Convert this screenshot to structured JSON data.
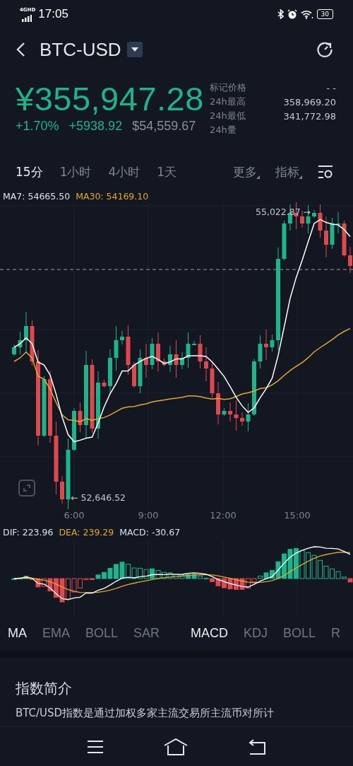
{
  "status_bar": {
    "network": "4GHD",
    "time": "17:05",
    "battery": "30"
  },
  "header": {
    "title": "BTC-USD"
  },
  "price": {
    "main": "¥355,947.28",
    "change_pct": "+1.70%",
    "change": "+5938.92",
    "usd": "$54,559.67"
  },
  "stats": [
    {
      "label": "标记价格",
      "value": "- -"
    },
    {
      "label": "24h最高",
      "value": "358,969.20"
    },
    {
      "label": "24h最低",
      "value": "341,772.98"
    },
    {
      "label": "24h量"
    }
  ],
  "timeframes": [
    {
      "label": "15分",
      "selected": true
    },
    {
      "label": "1小时",
      "selected": false
    },
    {
      "label": "4小时",
      "selected": false
    },
    {
      "label": "1天",
      "selected": false
    }
  ],
  "menus": [
    "更多",
    "指标"
  ],
  "chart": {
    "ma7": "MA7: 54665.50",
    "ma30": "MA30: 54169.10",
    "high_marker": "55,022.87 →",
    "low_marker": "← 52,646.52",
    "times": [
      "6:00",
      "9:00",
      "12:00",
      "15:00"
    ]
  },
  "macd": {
    "dif": "DIF: 223.96",
    "dea": "DEA: 239.29",
    "macd": "MACD: -30.67"
  },
  "main_indicators": [
    {
      "label": "MA",
      "selected": true
    },
    {
      "label": "EMA",
      "selected": false
    },
    {
      "label": "BOLL",
      "selected": false
    },
    {
      "label": "SAR",
      "selected": false
    }
  ],
  "sub_indicators": [
    {
      "label": "MACD",
      "selected": true
    },
    {
      "label": "KDJ",
      "selected": false
    },
    {
      "label": "BOLL",
      "selected": false
    },
    {
      "label": "R",
      "selected": false
    }
  ],
  "intro": {
    "title": "指数简介",
    "text": "BTC/USD指数是通过加权多家主流交易所主流币对所计"
  }
}
